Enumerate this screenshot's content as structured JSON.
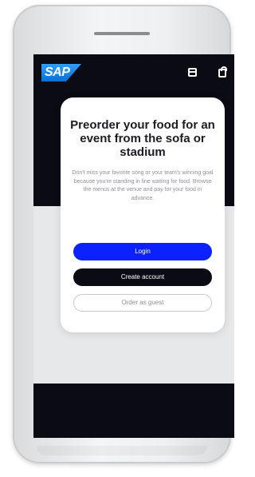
{
  "app": {
    "brand": "SAP",
    "brand_color": "#0a6ed1",
    "header_icons": [
      "calendar-icon",
      "shopping-bag-icon"
    ]
  },
  "modal": {
    "title": "Preorder your food for an event from the sofa or stadium",
    "description": "Don't miss your favorite song or your team's winning goal because you're standing in line waiting for food. Browse the menus at the venue and pay for your food in advance.",
    "buttons": {
      "login": "Login",
      "create_account": "Create account",
      "guest": "Order as guest"
    },
    "colors": {
      "login": "#0b22ff",
      "create_account": "#0b0b14",
      "guest_border": "#c7c9cc"
    }
  }
}
